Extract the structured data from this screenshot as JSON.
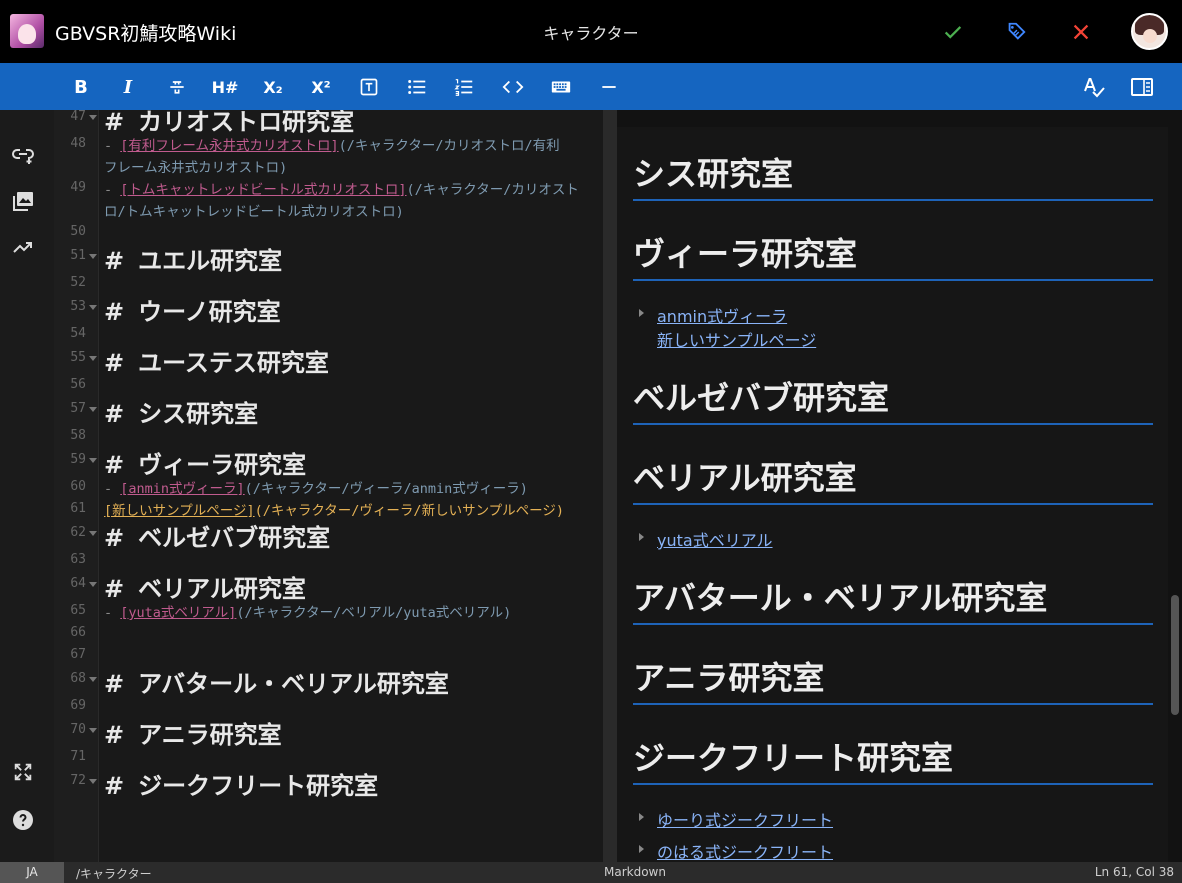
{
  "header": {
    "wiki_title": "GBVSR初鯖攻略Wiki",
    "page_title": "キャラクター",
    "actions": {
      "save": "save",
      "tag": "tag",
      "close": "close"
    },
    "colors": {
      "save": "#4caf50",
      "tag": "#3f87ff",
      "close": "#f44336"
    }
  },
  "toolbar": {
    "bold": "B",
    "italic": "I",
    "strike": "S",
    "heading": "H#",
    "subscript": "X₂",
    "superscript": "X²",
    "textbox": "T",
    "accent": "#1565c0"
  },
  "editor": {
    "lines": [
      {
        "n": "47",
        "type": "heading",
        "text": "カリオストロ研究室",
        "fold": true
      },
      {
        "n": "48",
        "type": "link",
        "label": "[有利フレーム永井式カリオストロ]",
        "url": "(/キャラクター/カリオストロ/有利",
        "cont": "フレーム永井式カリオストロ)"
      },
      {
        "n": "49",
        "type": "link",
        "label": "[トムキャットレッドビートル式カリオストロ]",
        "url": "(/キャラクター/カリオスト",
        "cont": "ロ/トムキャットレッドビートル式カリオストロ)"
      },
      {
        "n": "50",
        "type": "empty"
      },
      {
        "n": "51",
        "type": "heading",
        "text": "ユエル研究室",
        "fold": true
      },
      {
        "n": "52",
        "type": "empty"
      },
      {
        "n": "53",
        "type": "heading",
        "text": "ウーノ研究室",
        "fold": true
      },
      {
        "n": "54",
        "type": "empty"
      },
      {
        "n": "55",
        "type": "heading",
        "text": "ユーステス研究室",
        "fold": true
      },
      {
        "n": "56",
        "type": "empty"
      },
      {
        "n": "57",
        "type": "heading",
        "text": "シス研究室",
        "fold": true
      },
      {
        "n": "58",
        "type": "empty"
      },
      {
        "n": "59",
        "type": "heading",
        "text": "ヴィーラ研究室",
        "fold": true
      },
      {
        "n": "60",
        "type": "link",
        "label": "[anmin式ヴィーラ]",
        "url": "(/キャラクター/ヴィーラ/anmin式ヴィーラ)"
      },
      {
        "n": "61",
        "type": "plainlink",
        "label": "[新しいサンプルページ]",
        "url": "(/キャラクター/ヴィーラ/新しいサンプルページ)"
      },
      {
        "n": "62",
        "type": "heading",
        "text": "ベルゼバブ研究室",
        "fold": true
      },
      {
        "n": "63",
        "type": "empty"
      },
      {
        "n": "64",
        "type": "heading",
        "text": "ベリアル研究室",
        "fold": true
      },
      {
        "n": "65",
        "type": "link",
        "label": "[yuta式ベリアル]",
        "url": "(/キャラクター/ベリアル/yuta式ベリアル)"
      },
      {
        "n": "66",
        "type": "empty"
      },
      {
        "n": "67",
        "type": "empty"
      },
      {
        "n": "68",
        "type": "heading",
        "text": "アバタール・ベリアル研究室",
        "fold": true
      },
      {
        "n": "69",
        "type": "empty"
      },
      {
        "n": "70",
        "type": "heading",
        "text": "アニラ研究室",
        "fold": true
      },
      {
        "n": "71",
        "type": "empty"
      },
      {
        "n": "72",
        "type": "heading",
        "text": "ジークフリート研究室",
        "fold": true
      }
    ]
  },
  "preview": {
    "sections": [
      {
        "title": "シス研究室",
        "items": []
      },
      {
        "title": "ヴィーラ研究室",
        "items": [
          "anmin式ヴィーラ",
          "新しいサンプルページ"
        ]
      },
      {
        "title": "ベルゼバブ研究室",
        "items": []
      },
      {
        "title": "ベリアル研究室",
        "items": [
          "yuta式ベリアル"
        ]
      },
      {
        "title": "アバタール・ベリアル研究室",
        "items": []
      },
      {
        "title": "アニラ研究室",
        "items": []
      },
      {
        "title": "ジークフリート研究室",
        "items": [
          "ゆーり式ジークフリート",
          "のはる式ジークフリート"
        ]
      }
    ]
  },
  "status": {
    "lang": "JA",
    "path": "/キャラクター",
    "mode": "Markdown",
    "position": "Ln 61, Col 38"
  },
  "icons": {
    "rail": [
      "link-add-icon",
      "image-library-icon",
      "trend-icon",
      "fullscreen-icon",
      "help-icon"
    ]
  }
}
